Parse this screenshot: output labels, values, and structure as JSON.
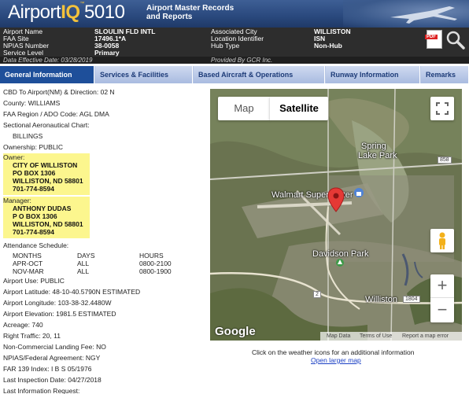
{
  "header": {
    "logo_prefix": "Airport",
    "logo_iq": "IQ",
    "logo_tm": "™",
    "logo_suffix": "5010",
    "tagline_line1": "Airport Master Records",
    "tagline_line2": "and Reports"
  },
  "info": {
    "airport_name_label": "Airport Name",
    "airport_name": "SLOULIN FLD INTL",
    "faa_site_label": "FAA Site",
    "faa_site": "17496.1*A",
    "npias_label": "NPIAS Number",
    "npias": "38-0058",
    "service_level_label": "Service Level",
    "service_level": "Primary",
    "assoc_city_label": "Associated City",
    "assoc_city": "WILLISTON",
    "loc_id_label": "Location Identifier",
    "loc_id": "ISN",
    "hub_type_label": "Hub Type",
    "hub_type": "Non-Hub",
    "effective_date": "Data Effective Date:  03/28/2019",
    "provided_by": "Provided By GCR Inc.",
    "pdf_badge": "PDF"
  },
  "tabs": [
    {
      "label": "General Information"
    },
    {
      "label": "Services & Facilities"
    },
    {
      "label": "Based Aircraft & Operations"
    },
    {
      "label": "Runway Information"
    },
    {
      "label": "Remarks"
    }
  ],
  "general": {
    "cbd": "CBD To Airport(NM) & Direction:  02 N",
    "county": "County:  WILLIAMS",
    "faa_region": "FAA Region / ADO Code:  AGL DMA",
    "sectional_label": "Sectional Aeronautical Chart:",
    "sectional_value": "BILLINGS",
    "ownership": "Ownership:  PUBLIC",
    "owner_label": "Owner:",
    "owner_lines": [
      "CITY OF WILLISTON",
      "PO BOX 1306",
      "WILLISTON, ND 58801",
      "701-774-8594"
    ],
    "manager_label": "Manager:",
    "manager_lines": [
      "ANTHONY DUDAS",
      "P O BOX 1306",
      "WILLISTON, ND 58801",
      "701-774-8594"
    ],
    "attendance_label": "Attendance Schedule:",
    "schedule_headers": [
      "MONTHS",
      "DAYS",
      "HOURS"
    ],
    "schedule_rows": [
      [
        "APR-OCT",
        "ALL",
        "0800-2100"
      ],
      [
        "NOV-MAR",
        "ALL",
        "0800-1900"
      ]
    ],
    "airport_use": "Airport Use:  PUBLIC",
    "latitude": "Airport Latitude:  48-10-40.5790N ESTIMATED",
    "longitude": "Airport Longitude:  103-38-32.4480W",
    "elevation": "Airport Elevation:  1981.5 ESTIMATED",
    "acreage": "Acreage:  740",
    "right_traffic": "Right Traffic:  20, 11",
    "landing_fee": "Non-Commercial Landing Fee:  NO",
    "npias_fed": "NPIAS/Federal Agreement:  NGY",
    "far139": "FAR 139 Index:  I B S 05/1976",
    "last_inspection": "Last Inspection Date:  04/27/2018",
    "last_info_request": "Last Information Request:"
  },
  "map": {
    "map_button": "Map",
    "satellite_button": "Satellite",
    "labels": {
      "spring_lake_1": "Spring",
      "spring_lake_2": "Lake Park",
      "walmart": "Walmart Supercenter",
      "davidson": "Davidson Park",
      "williston": "Williston",
      "route_858": "858",
      "route_1804": "1804",
      "route_2a": "2",
      "route_2b": "2"
    },
    "google": "Google",
    "attrib_data": "Map Data",
    "attrib_terms": "Terms of Use",
    "attrib_report": "Report a map error"
  },
  "footer": {
    "weather_note": "Click on the weather icons for an additional information",
    "larger_map": "Open larger map"
  },
  "colors": {
    "banner": "#2b4a7f",
    "logo_accent": "#f3c23b",
    "info_bg": "#2d2d2d",
    "tab_active": "#1e4f9a",
    "tab_inactive": "#b6c6e5",
    "highlight": "#fcf68e",
    "link": "#1a3fc4",
    "map_pin": "#e53935"
  }
}
